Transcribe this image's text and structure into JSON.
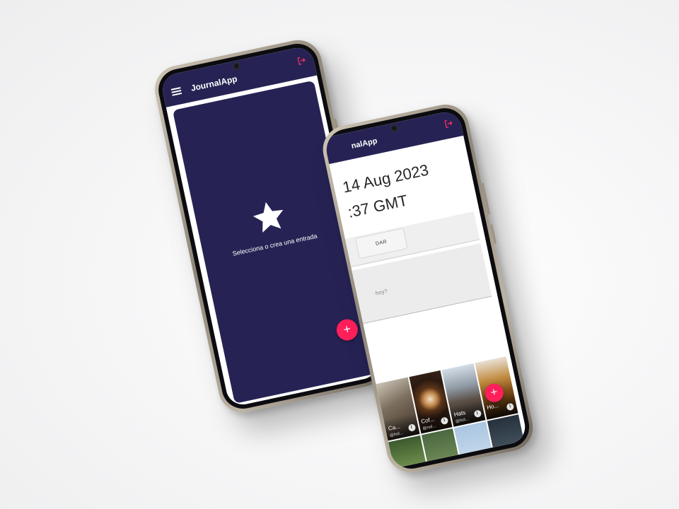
{
  "colors": {
    "appbar": "#262354",
    "panel": "#262354",
    "fab": "#ff1f5a",
    "accent_icon": "#ff2d62"
  },
  "left_phone": {
    "app_title": "JournalApp",
    "menu_icon": "hamburger-menu-icon",
    "logout_icon": "logout-icon",
    "empty_state": {
      "icon": "star-icon",
      "message": "Selecciona o crea una entrada"
    },
    "fab_label": "+"
  },
  "right_phone": {
    "app_title": "nalApp",
    "logout_icon": "logout-icon",
    "entry": {
      "date": "14 Aug 2023",
      "time": ":37 GMT",
      "save_label": "DAR",
      "body_placeholder": "hoy?"
    },
    "gallery": [
      {
        "title": "Ca...",
        "subtitle": "@hol...",
        "theme": "camera"
      },
      {
        "title": "Cof...",
        "subtitle": "@nol...",
        "theme": "coffee"
      },
      {
        "title": "Hats",
        "subtitle": "@hol...",
        "theme": "hats"
      },
      {
        "title": "Ho...",
        "subtitle": "",
        "theme": "honey"
      },
      {
        "title": "",
        "subtitle": "",
        "theme": "green"
      },
      {
        "title": "",
        "subtitle": "",
        "theme": "plant"
      },
      {
        "title": "",
        "subtitle": "",
        "theme": "sky"
      },
      {
        "title": "",
        "subtitle": "",
        "theme": "dark"
      }
    ],
    "fab_label": "+"
  }
}
